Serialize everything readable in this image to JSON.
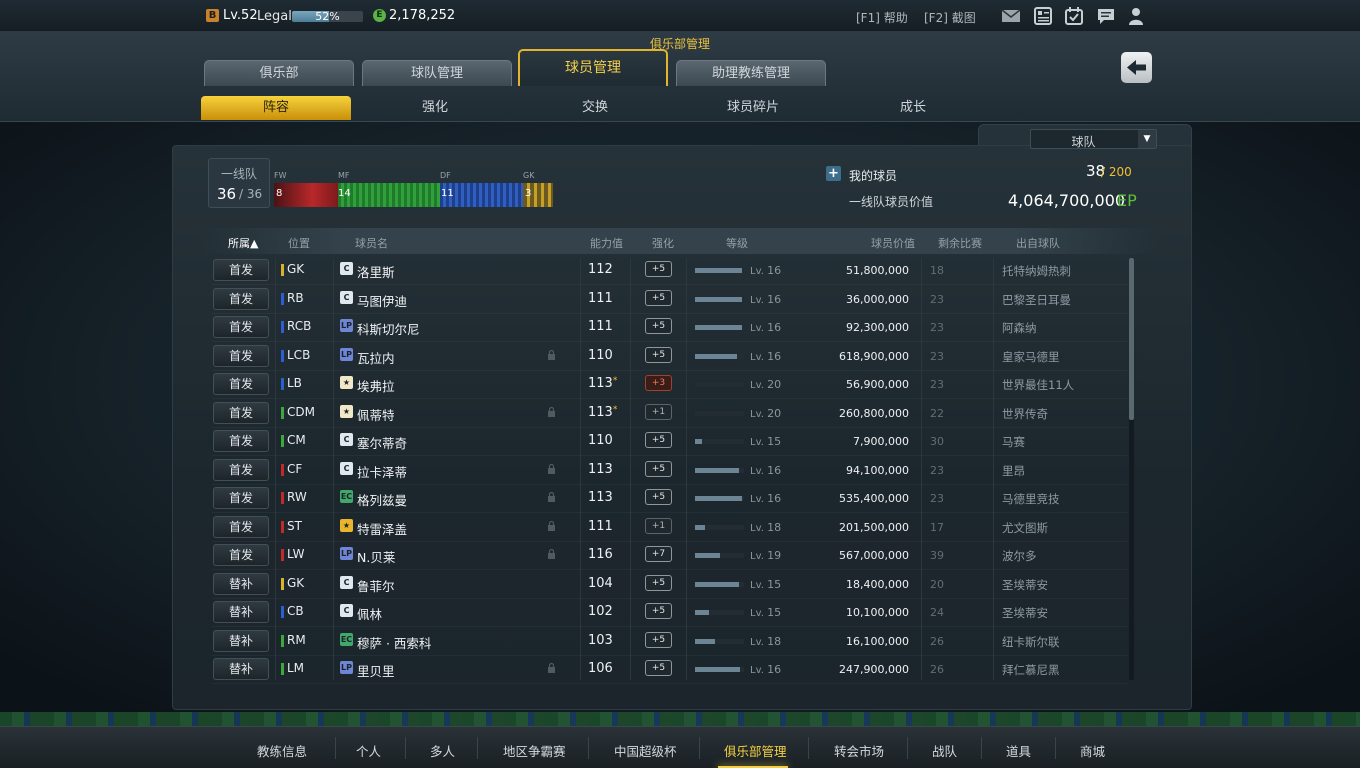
{
  "topbar": {
    "level_badge": "B",
    "level": "Lv.52",
    "rank": "Legal",
    "exp_percent": 52,
    "exp_text": "52%",
    "coin_badge": "E",
    "coins": "2,178,252",
    "help": "[F1] 帮助",
    "screenshot": "[F2] 截图",
    "icons": [
      "mail-icon",
      "card-icon",
      "calendar-check-icon",
      "chat-icon",
      "user-icon"
    ]
  },
  "header": {
    "section_title": "俱乐部管理",
    "tabs": [
      {
        "label": "俱乐部",
        "active": false
      },
      {
        "label": "球队管理",
        "active": false
      },
      {
        "label": "球员管理",
        "active": true
      },
      {
        "label": "助理教练管理",
        "active": false
      }
    ],
    "subtabs": [
      {
        "label": "阵容",
        "active": true
      },
      {
        "label": "强化",
        "active": false
      },
      {
        "label": "交换",
        "active": false
      },
      {
        "label": "球员碎片",
        "active": false
      },
      {
        "label": "成长",
        "active": false
      }
    ]
  },
  "panel": {
    "team_select": "球队",
    "squad_label": "一线队",
    "squad_count": "36",
    "squad_total": "/ 36",
    "positions": [
      {
        "label": "FW",
        "count": "8",
        "color": "#b8282a"
      },
      {
        "label": "MF",
        "count": "14",
        "color": "#2fa03a"
      },
      {
        "label": "DF",
        "count": "11",
        "color": "#2f5fc0"
      },
      {
        "label": "GK",
        "count": "3",
        "color": "#c7a027"
      }
    ],
    "my_players_label": "我的球员",
    "my_players_count": "38",
    "my_players_max": "/ 200",
    "value_label": "一线队球员价值",
    "value": "4,064,700,000",
    "value_unit": "EP"
  },
  "table": {
    "headers": {
      "type": "所属▲",
      "position": "位置",
      "name": "球员名",
      "ovr": "能力值",
      "enhance": "强化",
      "level": "等级",
      "value": "球员价值",
      "remain": "剩余比赛",
      "club": "出自球队"
    },
    "rows": [
      {
        "type": "首发",
        "pos": "GK",
        "pcolor": "#d9b22a",
        "season": "C",
        "scolor": "#dfe8ee",
        "name": "洛里斯",
        "lock": false,
        "ovr": "112",
        "star": "",
        "enh": "+5",
        "enh_style": "",
        "lv_fill": 0.95,
        "lv": "16",
        "value": "51,800,000",
        "remain": "18",
        "club": "托特纳姆热刺"
      },
      {
        "type": "首发",
        "pos": "RB",
        "pcolor": "#2c5ed0",
        "season": "C",
        "scolor": "#dfe8ee",
        "name": "马图伊迪",
        "lock": false,
        "ovr": "111",
        "star": "",
        "enh": "+5",
        "enh_style": "",
        "lv_fill": 0.95,
        "lv": "16",
        "value": "36,000,000",
        "remain": "23",
        "club": "巴黎圣日耳曼"
      },
      {
        "type": "首发",
        "pos": "RCB",
        "pcolor": "#2c5ed0",
        "season": "LP",
        "scolor": "#6f86d6",
        "name": "科斯切尔尼",
        "lock": false,
        "ovr": "111",
        "star": "",
        "enh": "+5",
        "enh_style": "",
        "lv_fill": 0.95,
        "lv": "16",
        "value": "92,300,000",
        "remain": "23",
        "club": "阿森纳"
      },
      {
        "type": "首发",
        "pos": "LCB",
        "pcolor": "#2c5ed0",
        "season": "LP",
        "scolor": "#6f86d6",
        "name": "瓦拉内",
        "lock": true,
        "ovr": "110",
        "star": "",
        "enh": "+5",
        "enh_style": "",
        "lv_fill": 0.85,
        "lv": "16",
        "value": "618,900,000",
        "remain": "23",
        "club": "皇家马德里"
      },
      {
        "type": "首发",
        "pos": "LB",
        "pcolor": "#2c5ed0",
        "season": "★",
        "scolor": "#f0e8c8",
        "name": "埃弗拉",
        "lock": false,
        "ovr": "113",
        "star": "*",
        "enh": "+3",
        "enh_style": "red",
        "lv_fill": 0.0,
        "lv": "20",
        "value": "56,900,000",
        "remain": "23",
        "club": "世界最佳11人"
      },
      {
        "type": "首发",
        "pos": "CDM",
        "pcolor": "#3aa83a",
        "season": "★",
        "scolor": "#f0e8c8",
        "name": "佩蒂特",
        "lock": true,
        "ovr": "113",
        "star": "*",
        "enh": "+1",
        "enh_style": "dim",
        "lv_fill": 0.0,
        "lv": "20",
        "value": "260,800,000",
        "remain": "22",
        "club": "世界传奇"
      },
      {
        "type": "首发",
        "pos": "CM",
        "pcolor": "#3aa83a",
        "season": "C",
        "scolor": "#dfe8ee",
        "name": "塞尔蒂奇",
        "lock": false,
        "ovr": "110",
        "star": "",
        "enh": "+5",
        "enh_style": "",
        "lv_fill": 0.15,
        "lv": "15",
        "value": "7,900,000",
        "remain": "30",
        "club": "马赛"
      },
      {
        "type": "首发",
        "pos": "CF",
        "pcolor": "#c22a2a",
        "season": "C",
        "scolor": "#dfe8ee",
        "name": "拉卡泽蒂",
        "lock": true,
        "ovr": "113",
        "star": "",
        "enh": "+5",
        "enh_style": "",
        "lv_fill": 0.9,
        "lv": "16",
        "value": "94,100,000",
        "remain": "23",
        "club": "里昂"
      },
      {
        "type": "首发",
        "pos": "RW",
        "pcolor": "#c22a2a",
        "season": "EC",
        "scolor": "#3fa86a",
        "name": "格列兹曼",
        "lock": true,
        "ovr": "113",
        "star": "",
        "enh": "+5",
        "enh_style": "",
        "lv_fill": 0.95,
        "lv": "16",
        "value": "535,400,000",
        "remain": "23",
        "club": "马德里竞技"
      },
      {
        "type": "首发",
        "pos": "ST",
        "pcolor": "#c22a2a",
        "season": "★",
        "scolor": "#e9b52a",
        "name": "特雷泽盖",
        "lock": true,
        "ovr": "111",
        "star": "",
        "enh": "+1",
        "enh_style": "dim",
        "lv_fill": 0.2,
        "lv": "18",
        "value": "201,500,000",
        "remain": "17",
        "club": "尤文图斯"
      },
      {
        "type": "首发",
        "pos": "LW",
        "pcolor": "#c22a2a",
        "season": "LP",
        "scolor": "#6f86d6",
        "name": "N.贝莱",
        "lock": true,
        "ovr": "116",
        "star": "",
        "enh": "+7",
        "enh_style": "",
        "lv_fill": 0.5,
        "lv": "19",
        "value": "567,000,000",
        "remain": "39",
        "club": "波尔多"
      },
      {
        "type": "替补",
        "pos": "GK",
        "pcolor": "#d9b22a",
        "season": "C",
        "scolor": "#dfe8ee",
        "name": "鲁菲尔",
        "lock": false,
        "ovr": "104",
        "star": "",
        "enh": "+5",
        "enh_style": "",
        "lv_fill": 0.9,
        "lv": "15",
        "value": "18,400,000",
        "remain": "20",
        "club": "圣埃蒂安"
      },
      {
        "type": "替补",
        "pos": "CB",
        "pcolor": "#2c5ed0",
        "season": "C",
        "scolor": "#dfe8ee",
        "name": "佩林",
        "lock": false,
        "ovr": "102",
        "star": "",
        "enh": "+5",
        "enh_style": "",
        "lv_fill": 0.28,
        "lv": "15",
        "value": "10,100,000",
        "remain": "24",
        "club": "圣埃蒂安"
      },
      {
        "type": "替补",
        "pos": "RM",
        "pcolor": "#3aa83a",
        "season": "EC",
        "scolor": "#3fa86a",
        "name": "穆萨 · 西索科",
        "lock": false,
        "ovr": "103",
        "star": "",
        "enh": "+5",
        "enh_style": "",
        "lv_fill": 0.4,
        "lv": "18",
        "value": "16,100,000",
        "remain": "26",
        "club": "纽卡斯尔联"
      },
      {
        "type": "替补",
        "pos": "LM",
        "pcolor": "#3aa83a",
        "season": "LP",
        "scolor": "#6f86d6",
        "name": "里贝里",
        "lock": true,
        "ovr": "106",
        "star": "",
        "enh": "+5",
        "enh_style": "",
        "lv_fill": 0.92,
        "lv": "16",
        "value": "247,900,000",
        "remain": "26",
        "club": "拜仁慕尼黑"
      }
    ]
  },
  "bottom_nav": [
    {
      "label": "教练信息",
      "active": false
    },
    {
      "label": "个人",
      "active": false
    },
    {
      "label": "多人",
      "active": false
    },
    {
      "label": "地区争霸赛",
      "active": false
    },
    {
      "label": "中国超级杯",
      "active": false
    },
    {
      "label": "俱乐部管理",
      "active": true
    },
    {
      "label": "转会市场",
      "active": false
    },
    {
      "label": "战队",
      "active": false
    },
    {
      "label": "道具",
      "active": false
    },
    {
      "label": "商城",
      "active": false
    }
  ]
}
